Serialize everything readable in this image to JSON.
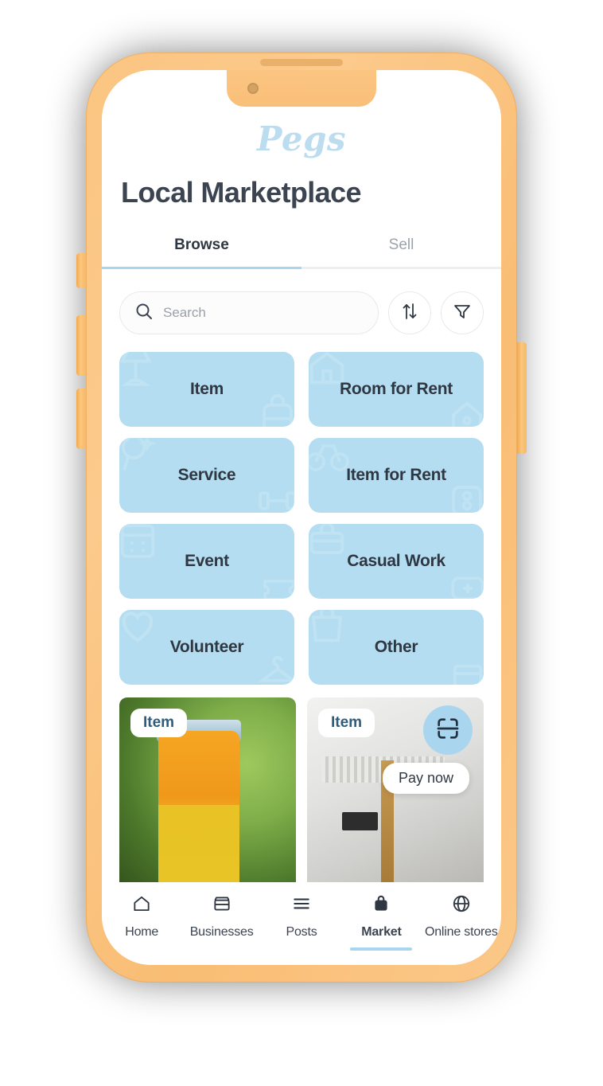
{
  "brand": {
    "logo_text": "Pegs"
  },
  "header": {
    "title": "Local Marketplace"
  },
  "tabs": [
    {
      "label": "Browse",
      "active": true
    },
    {
      "label": "Sell",
      "active": false
    }
  ],
  "search": {
    "placeholder": "Search",
    "value": "",
    "icon": "search-icon",
    "sort_icon": "sort-arrows-icon",
    "filter_icon": "filter-funnel-icon"
  },
  "categories": [
    {
      "label": "Item",
      "watermarks": [
        "lamp-icon",
        "backpack-icon"
      ]
    },
    {
      "label": "Room for Rent",
      "watermarks": [
        "house-icon",
        "home-tag-icon"
      ]
    },
    {
      "label": "Service",
      "watermarks": [
        "magnifier-icon",
        "dumbbell-icon"
      ]
    },
    {
      "label": "Item for Rent",
      "watermarks": [
        "bicycle-icon",
        "dice-icon"
      ]
    },
    {
      "label": "Event",
      "watermarks": [
        "calendar-icon",
        "ticket-icon"
      ]
    },
    {
      "label": "Casual Work",
      "watermarks": [
        "toolbox-icon",
        "first-aid-icon"
      ]
    },
    {
      "label": "Volunteer",
      "watermarks": [
        "heart-icon",
        "hanger-icon"
      ]
    },
    {
      "label": "Other",
      "watermarks": [
        "shopping-bag-icon",
        "box-icon"
      ]
    }
  ],
  "listings": [
    {
      "badge": "Item",
      "image_alt": "honey-jar-photo"
    },
    {
      "badge": "Item",
      "image_alt": "appliance-photo"
    }
  ],
  "floating": {
    "scan_icon": "scan-qr-icon",
    "pay_label": "Pay now"
  },
  "bottom_nav": [
    {
      "label": "Home",
      "icon": "home-icon",
      "active": false
    },
    {
      "label": "Businesses",
      "icon": "storefront-icon",
      "active": false
    },
    {
      "label": "Posts",
      "icon": "list-lines-icon",
      "active": false
    },
    {
      "label": "Market",
      "icon": "shopping-bag-filled-icon",
      "active": true
    },
    {
      "label": "Online stores",
      "icon": "globe-icon",
      "active": false
    }
  ],
  "colors": {
    "accent_blue": "#a9d6ee",
    "category_blue": "#b4ddf1",
    "text_dark": "#2f3842",
    "text_muted": "#9ba3ad",
    "phone_frame": "#fbc581",
    "badge_text": "#2c5d7e"
  }
}
